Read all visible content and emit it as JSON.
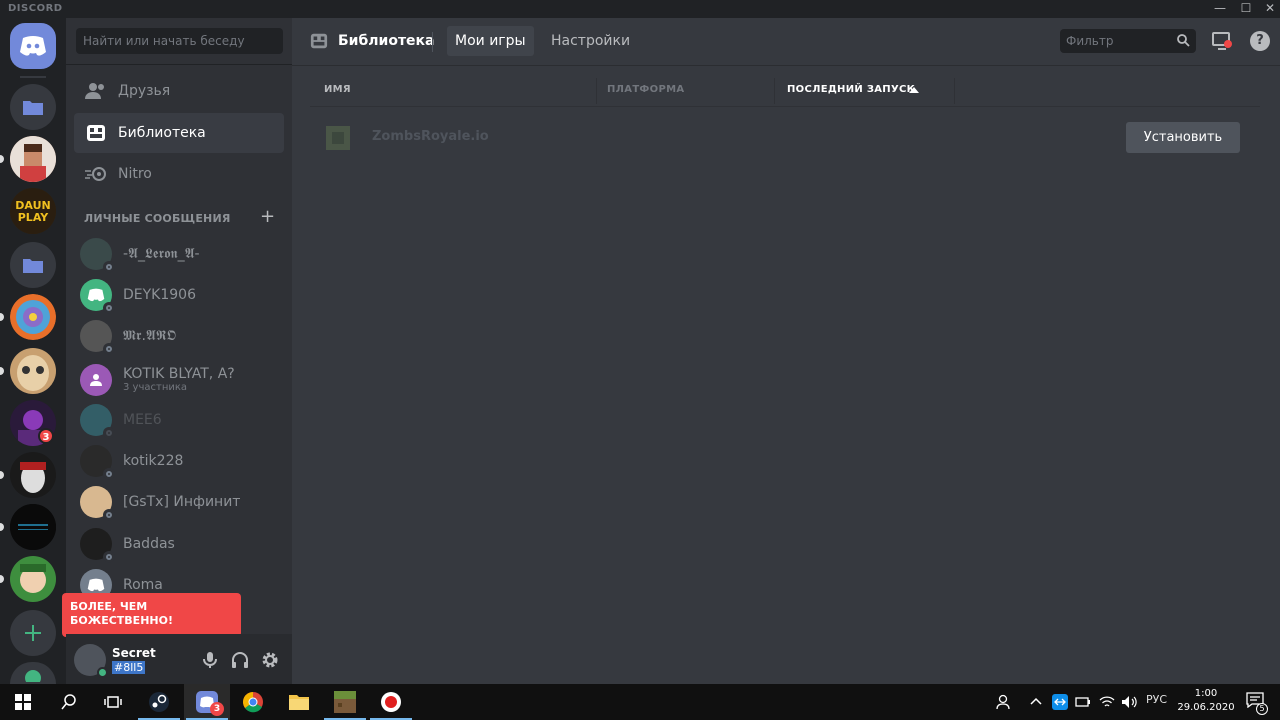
{
  "window": {
    "app_name": "DISCORD",
    "controls": {
      "minimize": "—",
      "maximize": "☐",
      "close": "✕"
    }
  },
  "guilds": {
    "badge_count": "3"
  },
  "sidebar": {
    "search_placeholder": "Найти или начать беседу",
    "nav": [
      {
        "label": "Друзья",
        "icon": "friends-icon"
      },
      {
        "label": "Библиотека",
        "icon": "library-icon",
        "active": true
      },
      {
        "label": "Nitro",
        "icon": "nitro-icon"
      }
    ],
    "dm_header": "ЛИЧНЫЕ СООБЩЕНИЯ",
    "dm_add": "+",
    "dms": [
      {
        "name": "-𝕬_𝕷𝖊𝖗𝖔𝖓_𝕬-",
        "sub": ""
      },
      {
        "name": "DEYK1906",
        "sub": ""
      },
      {
        "name": "𝕸𝖗.𝕬𝕽𝕺",
        "sub": ""
      },
      {
        "name": "KOTIK BLYAT, A?",
        "sub": "3 участника"
      },
      {
        "name": "MEE6",
        "sub": ""
      },
      {
        "name": "kotik228",
        "sub": ""
      },
      {
        "name": "[GsTx] Инфинит",
        "sub": ""
      },
      {
        "name": "Baddas",
        "sub": ""
      },
      {
        "name": "Roma",
        "sub": ""
      }
    ]
  },
  "tooltip": {
    "line1": "БОЛЕЕ, ЧЕМ",
    "line2": "БОЖЕСТВЕННО!"
  },
  "user": {
    "name": "Secret",
    "tag": "#8ll5"
  },
  "main": {
    "title": "Библиотека",
    "tabs": [
      {
        "label": "Мои игры",
        "selected": true
      },
      {
        "label": "Настройки",
        "selected": false
      }
    ],
    "filter_placeholder": "Фильтр",
    "columns": {
      "name": "ИМЯ",
      "platform": "ПЛАТФОРМА",
      "last_launch": "ПОСЛЕДНИЙ ЗАПУСК"
    },
    "games": [
      {
        "name": "ZombsRoyale.io",
        "action": "Установить"
      }
    ]
  },
  "taskbar": {
    "lang": "РУС",
    "time": "1:00",
    "date": "29.06.2020",
    "discord_badge": "3",
    "notif_count": "5"
  },
  "colors": {
    "blurple": "#7289da",
    "danger": "#f04747",
    "sidebar_bg": "#2f3136",
    "main_bg": "#36393f",
    "guild_bg": "#202225"
  }
}
